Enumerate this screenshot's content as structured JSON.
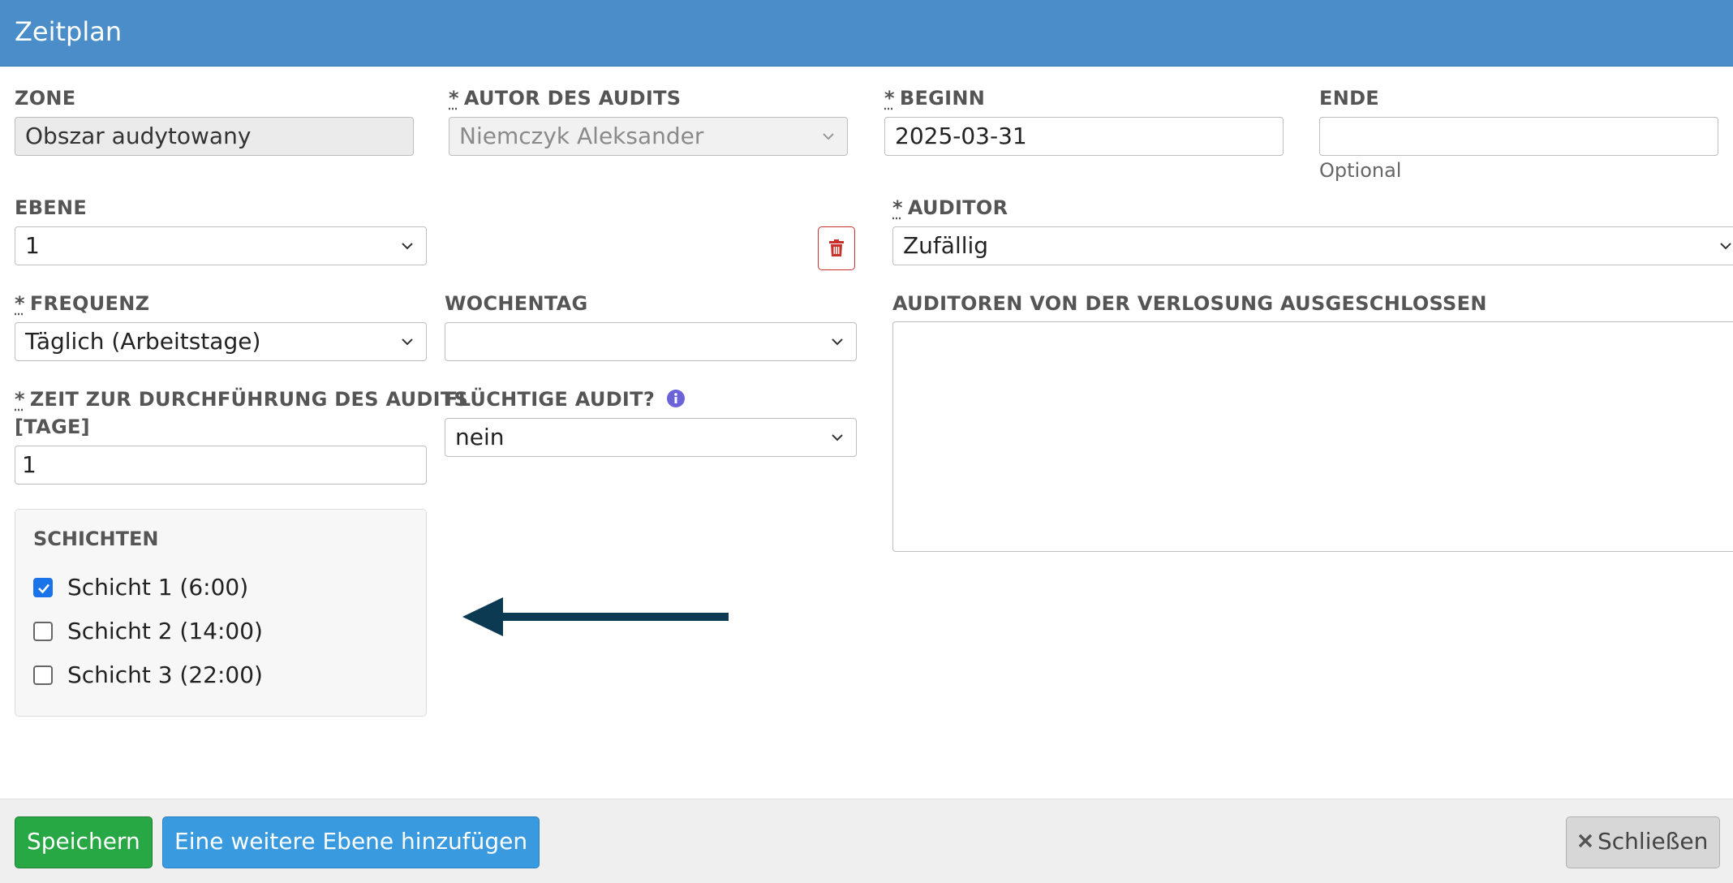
{
  "header": {
    "title": "Zeitplan"
  },
  "fields": {
    "zone": {
      "label": "ZONE",
      "value": "Obszar audytowany"
    },
    "author": {
      "label": "AUTOR DES AUDITS",
      "value": "Niemczyk Aleksander"
    },
    "begin": {
      "label": "BEGINN",
      "value": "2025-03-31"
    },
    "end": {
      "label": "ENDE",
      "value": "",
      "hint": "Optional"
    },
    "level": {
      "label": "EBENE",
      "value": "1"
    },
    "auditor": {
      "label": "AUDITOR",
      "value": "Zufällig"
    },
    "frequency": {
      "label": "FREQUENZ",
      "value": "Täglich (Arbeitstage)"
    },
    "weekday": {
      "label": "WOCHENTAG",
      "value": ""
    },
    "excluded": {
      "label": "AUDITOREN VON DER VERLOSUNG AUSGESCHLOSSEN"
    },
    "duration": {
      "label_line1": "ZEIT ZUR DURCHFÜHRUNG DES AUDITS",
      "label_line2": "[TAGE]",
      "value": "1"
    },
    "volatile": {
      "label": "FLÜCHTIGE AUDIT?",
      "value": "nein"
    }
  },
  "required_marker": "*",
  "shifts": {
    "title": "SCHICHTEN",
    "items": [
      {
        "label": "Schicht 1 (6:00)",
        "checked": true
      },
      {
        "label": "Schicht 2 (14:00)",
        "checked": false
      },
      {
        "label": "Schicht 3 (22:00)",
        "checked": false
      }
    ]
  },
  "footer": {
    "save_label": "Speichern",
    "add_level_label": "Eine weitere Ebene hinzufügen",
    "close_label": "Schließen"
  },
  "colors": {
    "header_bg": "#4a8dc8",
    "save_button": "#28a745",
    "add_button": "#3a9ae0",
    "delete_red": "#c9302c",
    "checkbox_blue": "#1a73e8",
    "arrow": "#0b3a52"
  },
  "icons": {
    "delete": "trash-icon",
    "info": "info-icon",
    "close": "close-icon",
    "dropdown": "chevron-down-icon",
    "pointer": "arrow-left-icon"
  }
}
